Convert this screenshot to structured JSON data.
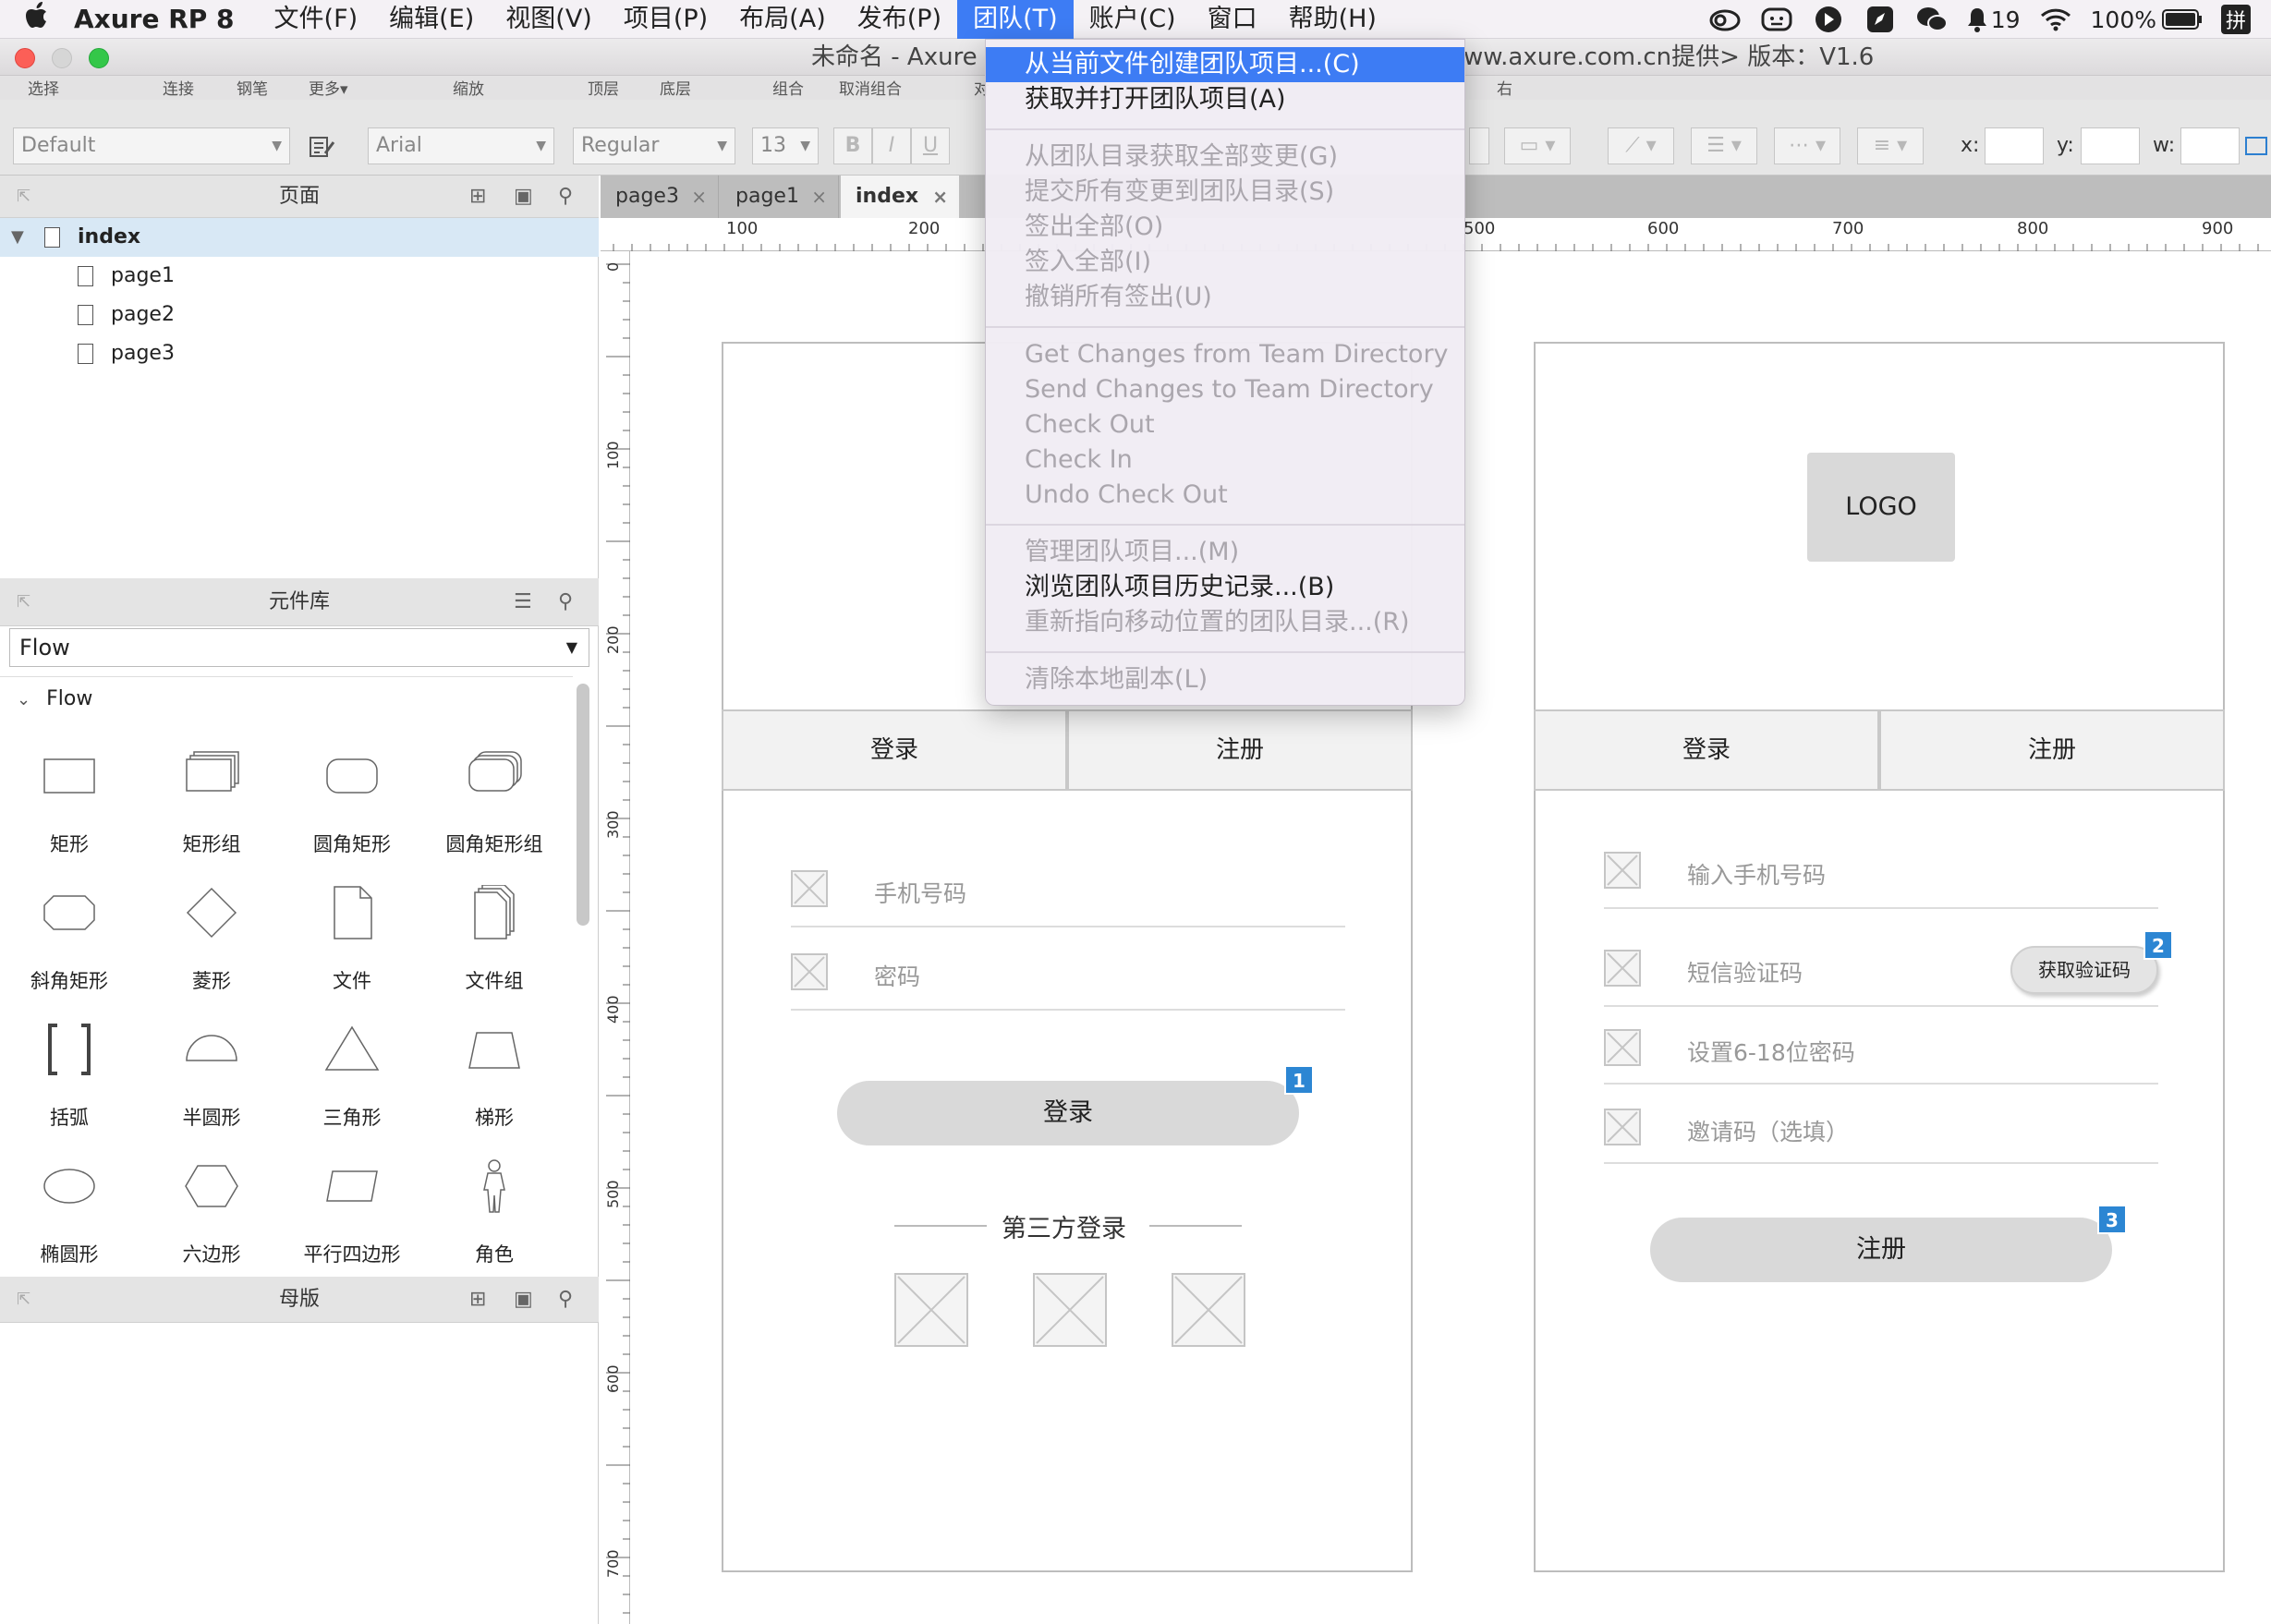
{
  "menubar": {
    "app_name": "Axure RP 8",
    "items": [
      "文件(F)",
      "编辑(E)",
      "视图(V)",
      "项目(P)",
      "布局(A)",
      "发布(P)",
      "团队(T)",
      "账户(C)",
      "窗口",
      "帮助(H)"
    ],
    "active_item": "团队(T)",
    "status": {
      "notifications": "19",
      "battery": "100%",
      "input_method": "拼"
    }
  },
  "window": {
    "title_left": "未命名 - Axure",
    "title_right": "ww.axure.com.cn提供> 版本：V1.6"
  },
  "toolbar": {
    "row1": [
      "选择",
      "连接",
      "钢笔",
      "更多▾",
      "缩放",
      "顶层",
      "底层",
      "组合",
      "取消组合",
      "对",
      "右"
    ],
    "style_select": "Default",
    "font_select": "Arial",
    "weight_select": "Regular",
    "size_select": "13",
    "bold": "B",
    "italic": "I",
    "underline": "U",
    "x_label": "x:",
    "y_label": "y:",
    "w_label": "w:"
  },
  "pages_panel": {
    "title": "页面",
    "root": "index",
    "children": [
      "page1",
      "page2",
      "page3"
    ]
  },
  "library_panel": {
    "title": "元件库",
    "selected_library": "Flow",
    "group": "Flow",
    "widgets": [
      "矩形",
      "矩形组",
      "圆角矩形",
      "圆角矩形组",
      "斜角矩形",
      "菱形",
      "文件",
      "文件组",
      "括弧",
      "半圆形",
      "三角形",
      "梯形",
      "椭圆形",
      "六边形",
      "平行四边形",
      "角色"
    ]
  },
  "masters_panel": {
    "title": "母版"
  },
  "tabs": [
    {
      "label": "page3",
      "active": false
    },
    {
      "label": "page1",
      "active": false
    },
    {
      "label": "index",
      "active": true
    }
  ],
  "ruler": {
    "h": [
      "100",
      "200",
      "500",
      "600",
      "700",
      "800",
      "900"
    ],
    "v": [
      "0",
      "100",
      "200",
      "300",
      "400",
      "500",
      "600",
      "700"
    ]
  },
  "canvas": {
    "login_screen": {
      "tabs": [
        "登录",
        "注册"
      ],
      "fields": [
        "手机号码",
        "密码"
      ],
      "submit": "登录",
      "badge": "1",
      "third_party": "第三方登录"
    },
    "register_screen": {
      "logo": "LOGO",
      "tabs": [
        "登录",
        "注册"
      ],
      "fields": [
        "输入手机号码",
        "短信验证码",
        "设置6-18位密码",
        "邀请码（选填）"
      ],
      "get_code": "获取验证码",
      "submit": "注册",
      "badges": [
        "2",
        "3"
      ]
    }
  },
  "team_menu": {
    "items": [
      {
        "label": "从当前文件创建团队项目...(C)",
        "state": "highlighted"
      },
      {
        "label": "获取并打开团队项目(A)",
        "state": "enabled"
      },
      {
        "label": "从团队目录获取全部变更(G)",
        "state": "disabled"
      },
      {
        "label": "提交所有变更到团队目录(S)",
        "state": "disabled"
      },
      {
        "label": "签出全部(O)",
        "state": "disabled"
      },
      {
        "label": "签入全部(I)",
        "state": "disabled"
      },
      {
        "label": "撤销所有签出(U)",
        "state": "disabled"
      },
      {
        "label": "Get Changes from Team Directory",
        "state": "disabled"
      },
      {
        "label": "Send Changes to Team Directory",
        "state": "disabled"
      },
      {
        "label": "Check Out",
        "state": "disabled"
      },
      {
        "label": "Check In",
        "state": "disabled"
      },
      {
        "label": "Undo Check Out",
        "state": "disabled"
      },
      {
        "label": "管理团队项目...(M)",
        "state": "disabled"
      },
      {
        "label": "浏览团队项目历史记录...(B)",
        "state": "enabled"
      },
      {
        "label": "重新指向移动位置的团队目录...(R)",
        "state": "disabled"
      },
      {
        "label": "清除本地副本(L)",
        "state": "disabled"
      }
    ]
  },
  "colors": {
    "menu_highlight": "#3d7cf4",
    "badge": "#2c86d3",
    "selection": "#d8e8f5"
  }
}
